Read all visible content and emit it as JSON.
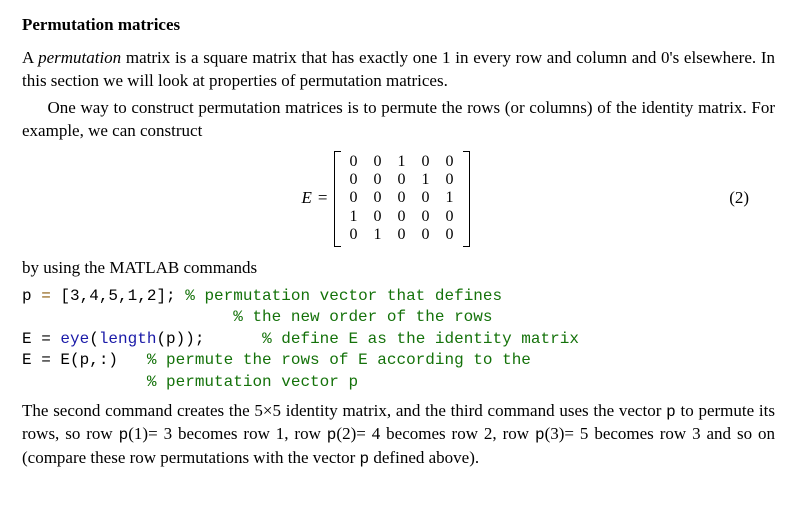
{
  "heading": "Permutation matrices",
  "para1_a": "A ",
  "para1_emph": "permutation",
  "para1_b": " matrix is a square matrix that has exactly one 1 in every row and column and 0's elsewhere. In this section we will look at properties of permutation matrices.",
  "para2": "One way to construct permutation matrices is to permute the rows (or columns) of the identity matrix. For example, we can construct",
  "eq_lhs_var": "E",
  "eq_equals": " = ",
  "eq_number": "(2)",
  "chart_data": {
    "type": "table",
    "title": "E",
    "rows": [
      [
        0,
        0,
        1,
        0,
        0
      ],
      [
        0,
        0,
        0,
        1,
        0
      ],
      [
        0,
        0,
        0,
        0,
        1
      ],
      [
        1,
        0,
        0,
        0,
        0
      ],
      [
        0,
        1,
        0,
        0,
        0
      ]
    ]
  },
  "para3": "by using the MATLAB commands",
  "code": {
    "l1_a": "p",
    "l1_eq": " = ",
    "l1_b": "[3,4,5,1,2];",
    "l1_c": " % permutation vector that defines",
    "l2": "                      % the new order of the rows",
    "l3_a": "E = ",
    "l3_b": "eye",
    "l3_c": "(",
    "l3_d": "length",
    "l3_e": "(p));      ",
    "l3_f": "% define E as the identity matrix",
    "l4_a": "E = E(p,:)   ",
    "l4_b": "% permute the rows of E according to the",
    "l5": "             % permutation vector p"
  },
  "para4_a": "The second command creates the 5×5 identity matrix, and the third command uses the vector ",
  "para4_p1": "p",
  "para4_b": " to permute its rows, so row ",
  "para4_p2": "p",
  "para4_c": "(1)= 3 becomes row 1, row ",
  "para4_p3": "p",
  "para4_d": "(2)= 4 becomes row 2, row ",
  "para4_p4": "p",
  "para4_e": "(3)= 5 becomes row 3 and so on (compare these row permutations with the vector ",
  "para4_p5": "p",
  "para4_f": " defined above)."
}
